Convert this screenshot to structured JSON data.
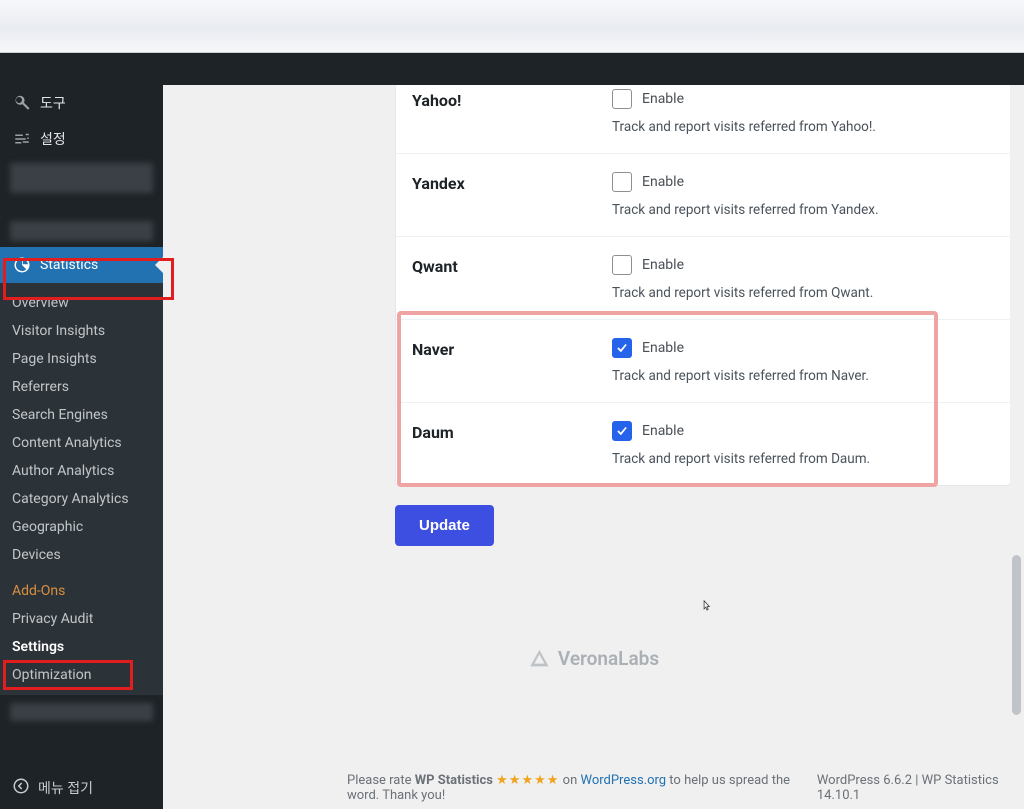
{
  "sidebar": {
    "tools": "도구",
    "settings": "설정",
    "statistics": "Statistics",
    "sub": {
      "overview": "Overview",
      "visitor_insights": "Visitor Insights",
      "page_insights": "Page Insights",
      "referrers": "Referrers",
      "search_engines": "Search Engines",
      "content_analytics": "Content Analytics",
      "author_analytics": "Author Analytics",
      "category_analytics": "Category Analytics",
      "geographic": "Geographic",
      "devices": "Devices",
      "addons": "Add-Ons",
      "privacy_audit": "Privacy Audit",
      "settings_sub": "Settings",
      "optimization": "Optimization"
    },
    "collapse": "메뉴 접기"
  },
  "engines": {
    "enable_label": "Enable",
    "yahoo": {
      "name": "Yahoo!",
      "desc": "Track and report visits referred from Yahoo!.",
      "checked": false
    },
    "yandex": {
      "name": "Yandex",
      "desc": "Track and report visits referred from Yandex.",
      "checked": false
    },
    "qwant": {
      "name": "Qwant",
      "desc": "Track and report visits referred from Qwant.",
      "checked": false
    },
    "naver": {
      "name": "Naver",
      "desc": "Track and report visits referred from Naver.",
      "checked": true
    },
    "daum": {
      "name": "Daum",
      "desc": "Track and report visits referred from Daum.",
      "checked": true
    }
  },
  "buttons": {
    "update": "Update"
  },
  "brand": "VeronaLabs",
  "footer": {
    "rate_pre": "Please rate ",
    "rate_bold": "WP Statistics",
    "stars": "★★★★★",
    "rate_mid1": " on ",
    "rate_link": "WordPress.org",
    "rate_post": " to help us spread the word. Thank you!",
    "version": "WordPress 6.6.2 | WP Statistics 14.10.1"
  }
}
